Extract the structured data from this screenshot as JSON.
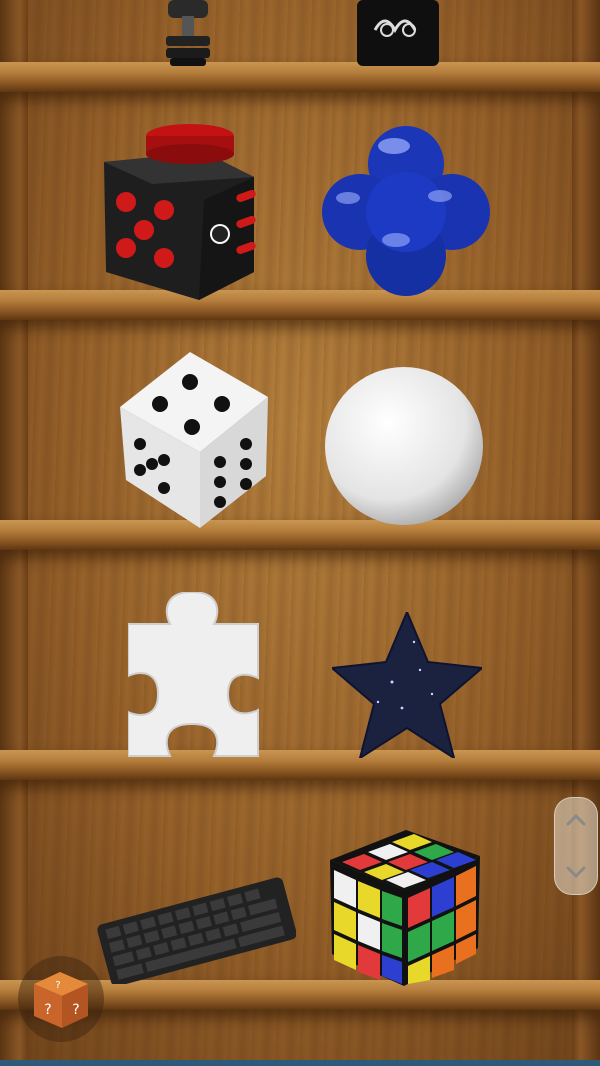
{
  "app": {
    "screen": "fidget-toy-shelf"
  },
  "shelves": [
    {
      "row": 1,
      "items": [
        "dumbbell",
        "black-phone-case"
      ]
    },
    {
      "row": 2,
      "items": [
        "fidget-cube",
        "blue-blob"
      ]
    },
    {
      "row": 3,
      "items": [
        "dice",
        "golf-ball"
      ]
    },
    {
      "row": 4,
      "items": [
        "puzzle-piece",
        "star"
      ]
    },
    {
      "row": 5,
      "items": [
        "keyboard",
        "rubiks-cube"
      ]
    }
  ],
  "controls": {
    "scroll_up_icon": "chevron-up-icon",
    "scroll_down_icon": "chevron-down-icon",
    "random_button_icon": "question-box-icon",
    "random_button_mark": "?"
  },
  "colors": {
    "wood": "#96612a",
    "shelf": "#b57e3c",
    "fidget_red": "#d01a1a",
    "blob_blue": "#1c36b8",
    "star_navy": "#1a2240"
  }
}
